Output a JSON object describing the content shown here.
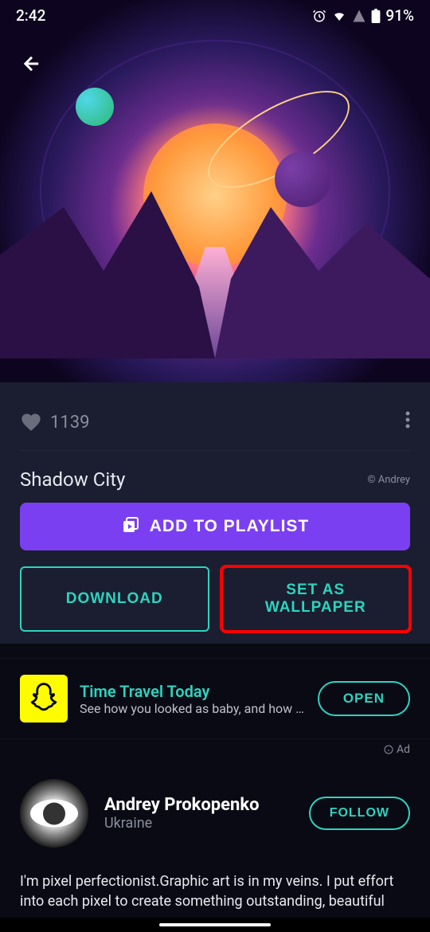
{
  "status_bar": {
    "time": "2:42",
    "battery": "91%"
  },
  "wallpaper": {
    "likes": "1139",
    "title": "Shadow City",
    "copyright": "© Andrey"
  },
  "buttons": {
    "add_playlist": "ADD TO PLAYLIST",
    "download": "DOWNLOAD",
    "set_wallpaper": "SET AS WALLPAPER"
  },
  "ad": {
    "title": "Time Travel Today",
    "subtitle": "See how you looked as baby, and how y…",
    "open": "OPEN",
    "label": "Ad"
  },
  "author": {
    "name": "Andrey Prokopenko",
    "location": "Ukraine",
    "follow": "FOLLOW",
    "bio": "I'm pixel perfectionist.Graphic art is in my veins. I put effort into each pixel to create something outstanding, beautiful"
  }
}
